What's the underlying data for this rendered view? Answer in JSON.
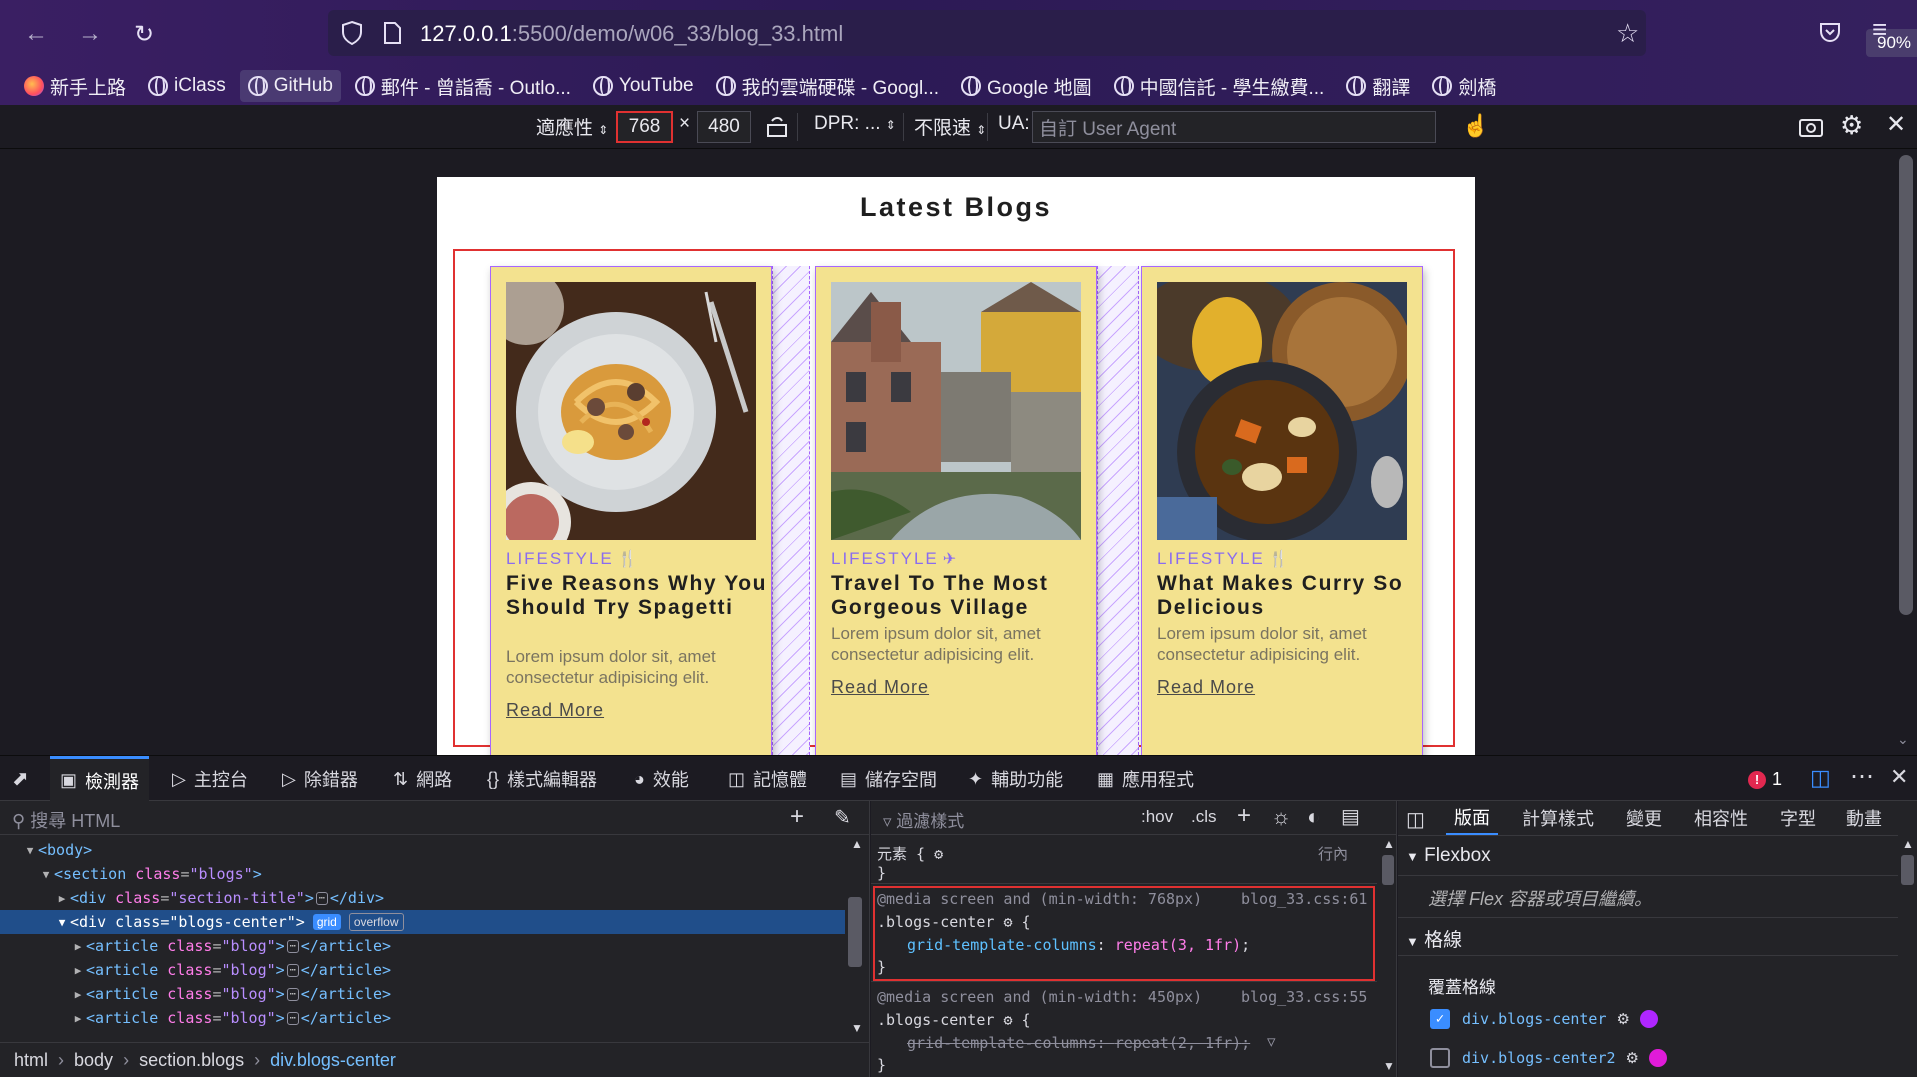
{
  "browser": {
    "url_host": "127.0.0.1",
    "url_path": ":5500/demo/w06_33/blog_33.html",
    "zoom": "90%",
    "bookmarks": [
      {
        "label": "新手上路",
        "icon": "firefox-icon"
      },
      {
        "label": "iClass",
        "icon": "globe-icon"
      },
      {
        "label": "GitHub",
        "icon": "globe-icon"
      },
      {
        "label": "郵件 - 曾詣喬 - Outlo...",
        "icon": "globe-icon"
      },
      {
        "label": "YouTube",
        "icon": "globe-icon"
      },
      {
        "label": "我的雲端硬碟 - Googl...",
        "icon": "globe-icon"
      },
      {
        "label": "Google 地圖",
        "icon": "globe-icon"
      },
      {
        "label": "中國信託 - 學生繳費...",
        "icon": "globe-icon"
      },
      {
        "label": "翻譯",
        "icon": "globe-icon"
      },
      {
        "label": "劍橋",
        "icon": "globe-icon"
      }
    ]
  },
  "rdm": {
    "device": "適應性",
    "width": "768",
    "times": "×",
    "height": "480",
    "dpr": "DPR: ...",
    "throttle": "不限速",
    "ua_label": "UA:",
    "ua_placeholder": "自訂 User Agent"
  },
  "page": {
    "title": "Latest Blogs",
    "blogs": [
      {
        "category": "LIFESTYLE",
        "category_icon": "utensils-icon",
        "title": "Five Reasons Why You Should Try Spagetti",
        "text": "Lorem ipsum dolor sit, amet consectetur adipisicing elit.",
        "link": "Read More",
        "image": "spaghetti-photo"
      },
      {
        "category": "LIFESTYLE",
        "category_icon": "plane-icon",
        "title": "Travel To The Most Gorgeous Village",
        "text": "Lorem ipsum dolor sit, amet consectetur adipisicing elit.",
        "link": "Read More",
        "image": "village-photo"
      },
      {
        "category": "LIFESTYLE",
        "category_icon": "utensils-icon",
        "title": "What Makes Curry So Delicious",
        "text": "Lorem ipsum dolor sit, amet consectetur adipisicing elit.",
        "link": "Read More",
        "image": "curry-photo"
      }
    ]
  },
  "devtools": {
    "tabs": [
      "檢測器",
      "主控台",
      "除錯器",
      "網路",
      "樣式編輯器",
      "效能",
      "記憶體",
      "儲存空間",
      "輔助功能",
      "應用程式"
    ],
    "error_count": "1",
    "html_search_placeholder": "搜尋 HTML",
    "tree": {
      "body": "body",
      "section_tag": "section",
      "section_attr": "class",
      "section_val": "\"blogs\"",
      "title_tag": "div",
      "title_val": "\"section-title\"",
      "center_tag": "div",
      "center_val": "\"blogs-center\"",
      "badge_grid": "grid",
      "badge_overflow": "overflow",
      "article_tag": "article",
      "article_val": "\"blog\""
    },
    "breadcrumb": [
      "html",
      "body",
      "section.blogs",
      "div.blogs-center"
    ],
    "rules": {
      "filter_placeholder": "過濾樣式",
      "hov": ":hov",
      "cls": ".cls",
      "element_label": "元素 {",
      "element_close": "}",
      "inline_label": "行內",
      "media1": "@media screen and (min-width: 768px)",
      "src1": "blog_33.css:61",
      "selector1": ".blogs-center",
      "prop1": "grid-template-columns",
      "val1": "repeat(3, 1fr)",
      "media2": "@media screen and (min-width: 450px)",
      "src2": "blog_33.css:55",
      "selector2": ".blogs-center",
      "prop2": "grid-template-columns",
      "val2": "repeat(2, 1fr)"
    },
    "layout": {
      "tabs": [
        "版面",
        "計算樣式",
        "變更",
        "相容性",
        "字型",
        "動畫"
      ],
      "flexbox_header": "Flexbox",
      "flexbox_note": "選擇 Flex 容器或項目繼續。",
      "grid_header": "格線",
      "overlay_label": "覆蓋格線",
      "grids": [
        {
          "name": "div.blogs-center",
          "checked": true,
          "color": "#b026ff"
        },
        {
          "name": "div.blogs-center2",
          "checked": false,
          "color": "#e01bd9"
        }
      ]
    }
  }
}
